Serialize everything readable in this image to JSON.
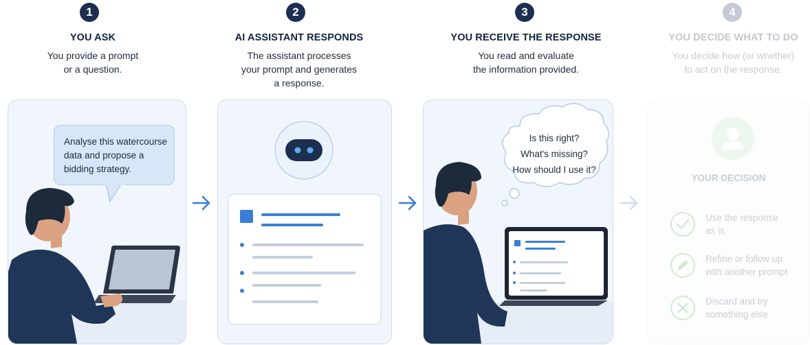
{
  "steps": [
    {
      "number": "1",
      "title": "YOU ASK",
      "desc": [
        "You provide a prompt",
        "or a question."
      ],
      "bubble": [
        "Analyse this watercourse",
        "data and propose a",
        "bidding strategy."
      ]
    },
    {
      "number": "2",
      "title": "AI ASSISTANT RESPONDS",
      "desc": [
        "The assistant processes",
        "your prompt and generates",
        "a response."
      ]
    },
    {
      "number": "3",
      "title": "YOU RECEIVE THE RESPONSE",
      "desc": [
        "You read and evaluate",
        "the information provided."
      ],
      "thought": [
        "Is this right?",
        "What's missing?",
        "How should I use it?"
      ]
    },
    {
      "number": "4",
      "title": "YOU DECIDE WHAT TO DO",
      "desc": [
        "You decide how (or whether)",
        "to act on the response."
      ],
      "decision_title": "YOUR DECISION",
      "options": [
        {
          "icon": "check-icon",
          "lines": [
            "Use the response",
            "as is"
          ]
        },
        {
          "icon": "pencil-icon",
          "lines": [
            "Refine or follow up",
            "with another prompt"
          ]
        },
        {
          "icon": "x-icon",
          "lines": [
            "Discard and try",
            "something else"
          ]
        }
      ]
    }
  ],
  "colors": {
    "navy": "#1c2f4f",
    "accent": "#3a7fd5",
    "faded_step": "#e3ebe2"
  }
}
